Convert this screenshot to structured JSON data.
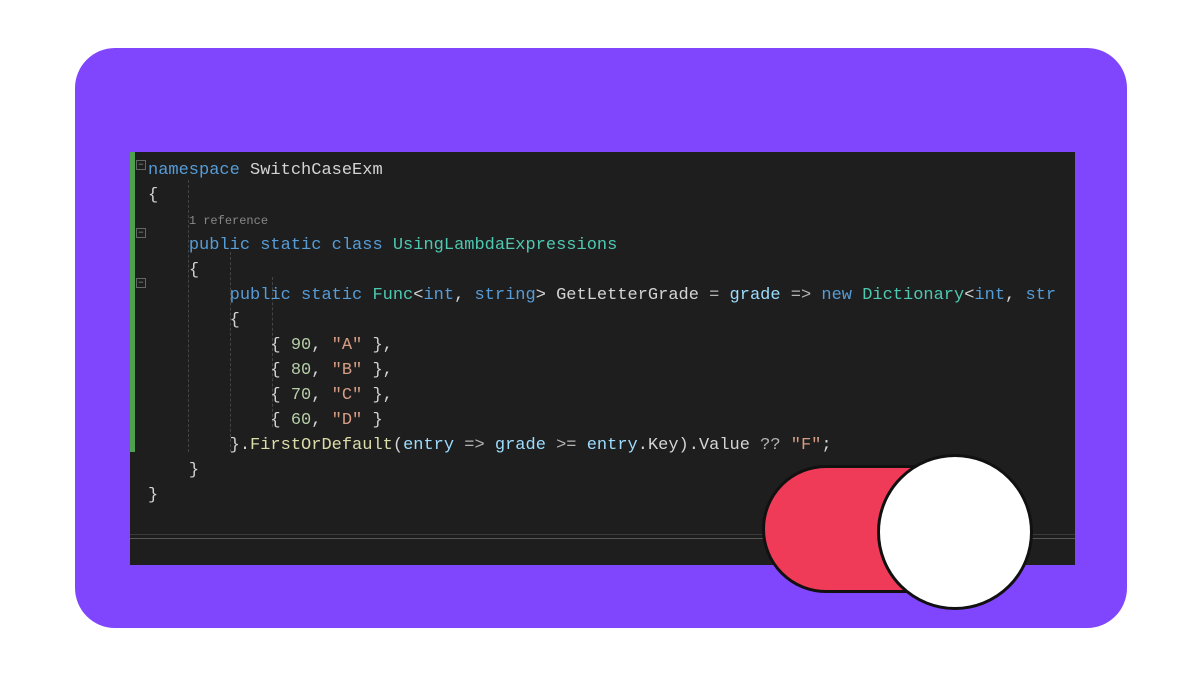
{
  "code": {
    "namespace_kw": "namespace",
    "namespace_name": " SwitchCaseExm",
    "open_brace": "{",
    "codelens": "1 reference",
    "class_decl_kw": "public static class ",
    "class_name": "UsingLambdaExpressions",
    "class_open": "{",
    "field_mods": "public static ",
    "func_type": "Func",
    "generic_open": "<",
    "int_t": "int",
    "comma_sp": ", ",
    "string_t": "string",
    "generic_close": "> ",
    "field_name": "GetLetterGrade",
    "assign": " = ",
    "param1": "grade",
    "arrow": " => ",
    "new_kw": "new ",
    "dict_type": "Dictionary",
    "dict_gen": "<",
    "dict_int": "int",
    "dict_comma": ", ",
    "dict_str_trunc": "str",
    "init_open": "{",
    "entry1_open": "    { ",
    "entry1_key": "90",
    "entry1_sep": ", ",
    "entry1_val": "\"A\"",
    "entry1_close": " },",
    "entry2_open": "    { ",
    "entry2_key": "80",
    "entry2_sep": ", ",
    "entry2_val": "\"B\"",
    "entry2_close": " },",
    "entry3_open": "    { ",
    "entry3_key": "70",
    "entry3_sep": ", ",
    "entry3_val": "\"C\"",
    "entry3_close": " },",
    "entry4_open": "    { ",
    "entry4_key": "60",
    "entry4_sep": ", ",
    "entry4_val": "\"D\"",
    "entry4_close": " }",
    "init_close": "}",
    "dot1": ".",
    "first_or_default": "FirstOrDefault",
    "call_open": "(",
    "lambda_p": "entry",
    "lambda_arrow": " => ",
    "grade_ref": "grade",
    "gte": " >= ",
    "entry_ref": "entry",
    "dot2": ".",
    "key_prop": "Key",
    "call_close": ")",
    "dot3": ".",
    "value_prop": "Value",
    "coalesce": " ?? ",
    "fallback": "\"F\"",
    "semi": ";",
    "class_close": "}",
    "ns_close": "}"
  },
  "fold": {
    "minus": "−"
  },
  "toggle": {
    "state": "on"
  }
}
